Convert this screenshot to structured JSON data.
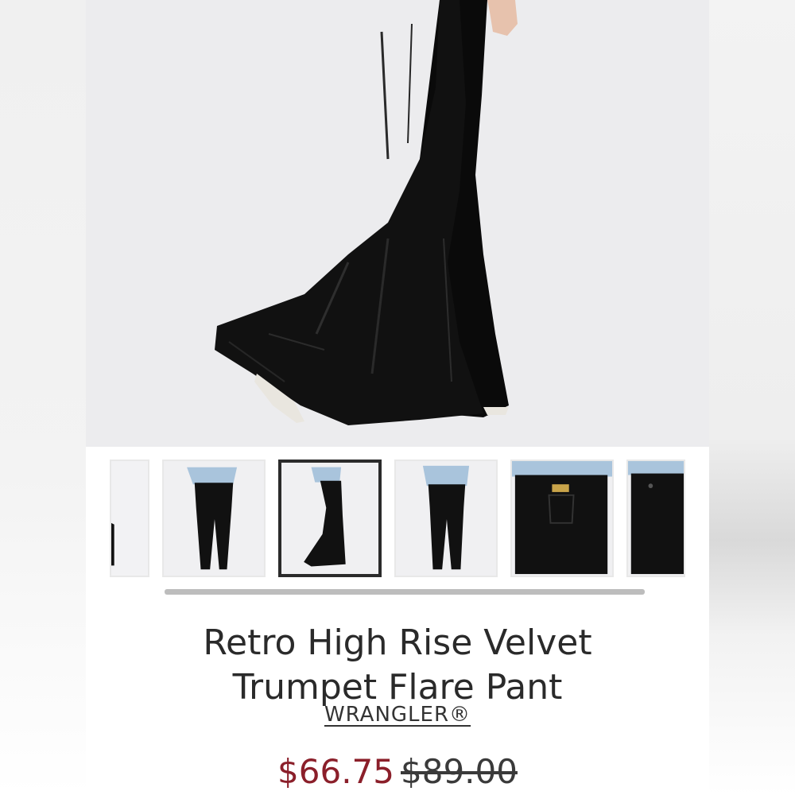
{
  "product": {
    "title_line1": "Retro High Rise Velvet",
    "title_line2": "Trumpet Flare Pant",
    "brand": "WRANGLER®",
    "sale_price": "$66.75",
    "original_price": "$89.00"
  },
  "gallery": {
    "main_image": "black velvet flare pants side view",
    "thumbnails": [
      {
        "alt": "partial view",
        "selected": false
      },
      {
        "alt": "front full length",
        "selected": false
      },
      {
        "alt": "side full length",
        "selected": true
      },
      {
        "alt": "back full length",
        "selected": false
      },
      {
        "alt": "back pocket detail",
        "selected": false
      },
      {
        "alt": "front waist detail",
        "selected": false
      }
    ]
  },
  "colors": {
    "sale": "#8b1f2a",
    "text": "#2a2a2a",
    "fabric": "#0d0d0d",
    "selected_border": "#2b2b2b"
  }
}
